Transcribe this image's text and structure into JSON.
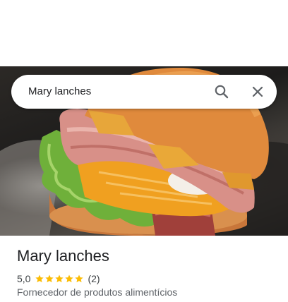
{
  "search": {
    "query": "Mary lanches"
  },
  "place": {
    "name": "Mary lanches",
    "rating": "5,0",
    "rating_stars": 5,
    "review_count": "(2)",
    "category": "Fornecedor de produtos alimentícios"
  },
  "colors": {
    "star": "#fbbc04",
    "text": "#202124",
    "secondary": "#5f6368",
    "icon": "#5f6368"
  },
  "icons": {
    "search": "search-icon",
    "close": "close-icon",
    "star": "star-icon"
  }
}
